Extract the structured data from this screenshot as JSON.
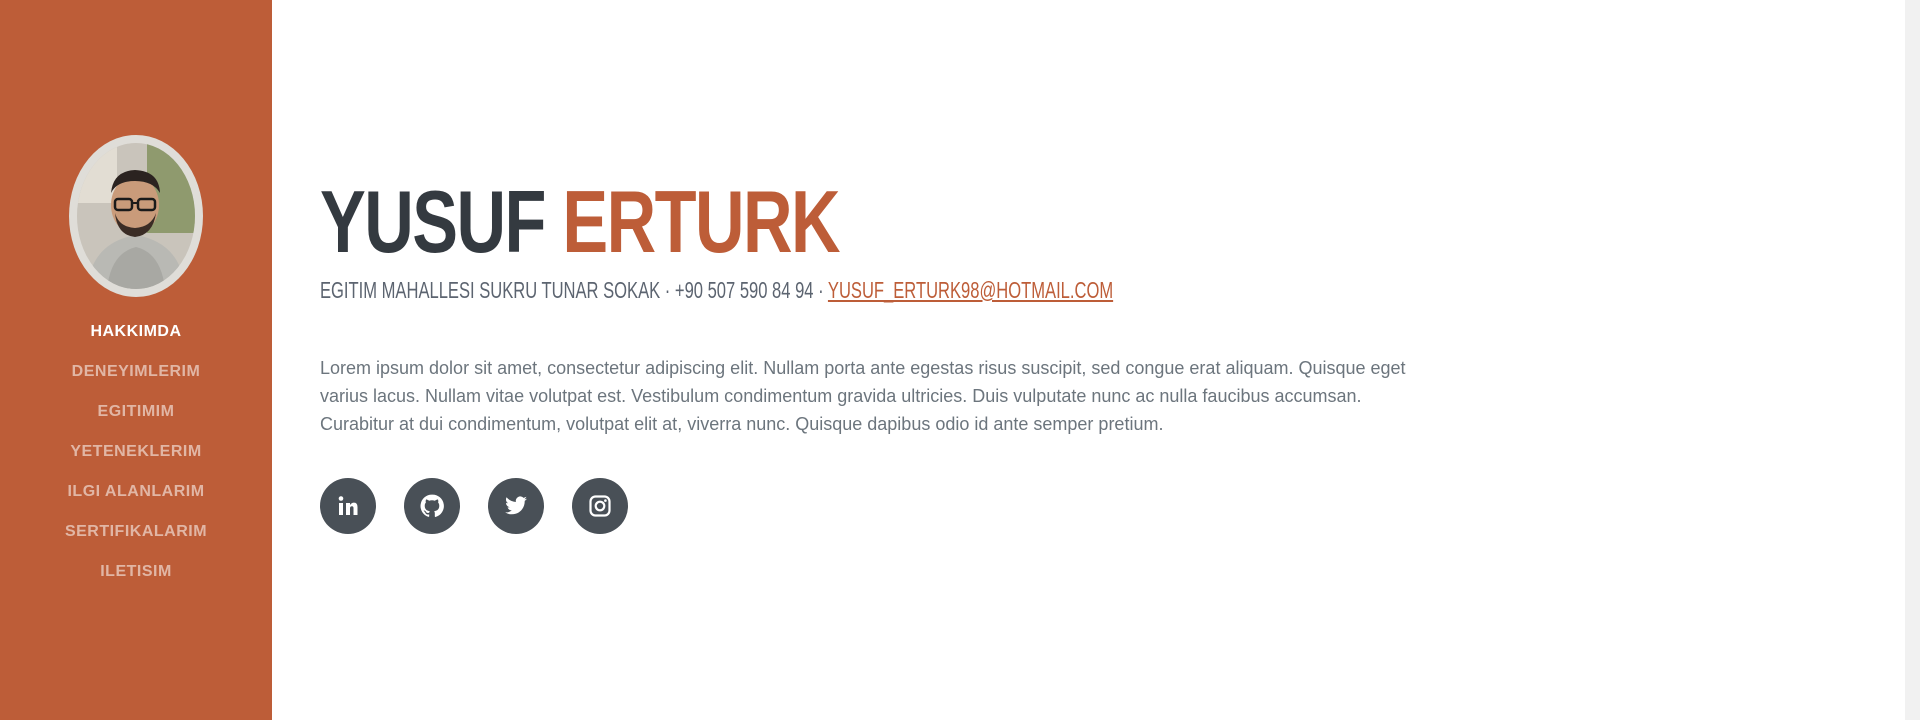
{
  "sidebar": {
    "background": "#bd5d38",
    "nav": [
      {
        "label": "HAKKIMDA",
        "active": true
      },
      {
        "label": "DENEYIMLERIM"
      },
      {
        "label": "EGITIMIM"
      },
      {
        "label": "YETENEKLERIM"
      },
      {
        "label": "ILGI ALANLARIM"
      },
      {
        "label": "SERTIFIKALARIM"
      },
      {
        "label": "ILETISIM"
      }
    ]
  },
  "profile": {
    "first_name": "YUSUF",
    "last_name": "ERTURK",
    "address": "EGITIM MAHALLESI SUKRU TUNAR SOKAK",
    "separator": " · ",
    "phone": "+90 507 590 84 94",
    "email": "YUSUF_ERTURK98@HOTMAIL.COM",
    "bio": "Lorem ipsum dolor sit amet, consectetur adipiscing elit. Nullam porta ante egestas risus suscipit, sed congue erat aliquam. Quisque eget varius lacus. Nullam vitae volutpat est. Vestibulum condimentum gravida ultricies. Duis vulputate nunc ac nulla faucibus accumsan. Curabitur at dui condimentum, volutpat elit at, viverra nunc. Quisque dapibus odio id ante semper pretium."
  },
  "social": [
    {
      "icon": "linkedin-icon"
    },
    {
      "icon": "github-icon"
    },
    {
      "icon": "twitter-icon"
    },
    {
      "icon": "instagram-icon"
    }
  ],
  "colors": {
    "accent": "#bd5d38",
    "heading": "#343a40",
    "social_bg": "#495057"
  }
}
